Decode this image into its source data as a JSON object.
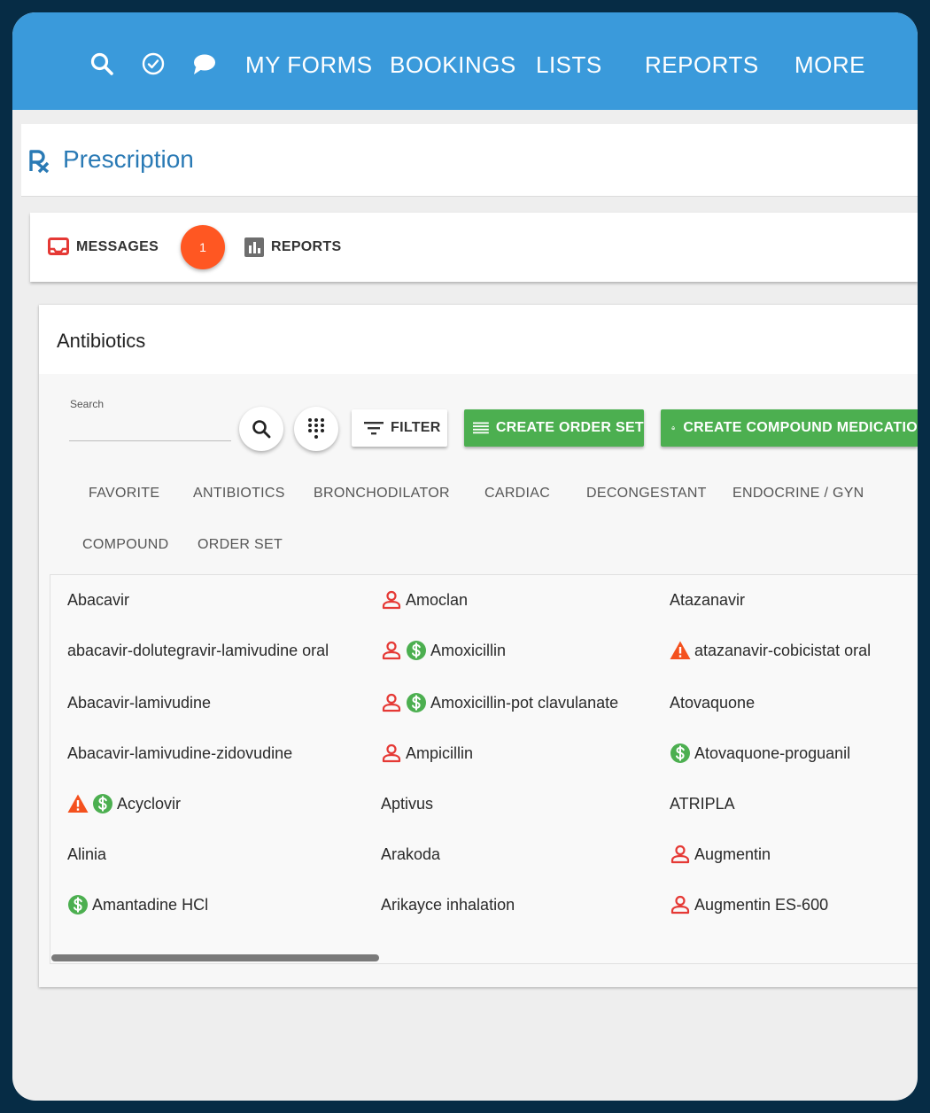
{
  "nav": {
    "icons": [
      "search-icon",
      "check-circle-icon",
      "chat-bubble-icon"
    ],
    "items": [
      "MY FORMS",
      "BOOKINGS",
      "LISTS",
      "REPORTS",
      "MORE"
    ]
  },
  "page": {
    "title": "Prescription",
    "icon": "rx-icon"
  },
  "tabs": [
    {
      "label": "MESSAGES",
      "icon": "inbox-icon",
      "badge": "1"
    },
    {
      "label": "REPORTS",
      "icon": "bar-chart-icon"
    }
  ],
  "card": {
    "title": "Antibiotics",
    "search": {
      "label": "Search",
      "value": ""
    },
    "buttons": {
      "filter": "FILTER",
      "create_order_set": "CREATE ORDER SET",
      "create_compound": "CREATE COMPOUND MEDICATIO"
    },
    "categories": [
      "FAVORITE",
      "ANTIBIOTICS",
      "BRONCHODILATOR",
      "CARDIAC",
      "DECONGESTANT",
      "ENDOCRINE / GYN",
      "COMPOUND",
      "ORDER SET"
    ],
    "columns": [
      [
        {
          "name": "Abacavir",
          "icons": []
        },
        {
          "name": "abacavir-dolutegravir-lamivudine oral",
          "icons": []
        },
        {
          "name": "Abacavir-lamivudine",
          "icons": []
        },
        {
          "name": "Abacavir-lamivudine-zidovudine",
          "icons": []
        },
        {
          "name": "Acyclovir",
          "icons": [
            "warning-icon",
            "dollar-icon"
          ]
        },
        {
          "name": "Alinia",
          "icons": []
        },
        {
          "name": "Amantadine HCl",
          "icons": [
            "dollar-icon"
          ]
        }
      ],
      [
        {
          "name": "Amoclan",
          "icons": [
            "person-icon"
          ]
        },
        {
          "name": "Amoxicillin",
          "icons": [
            "person-icon",
            "dollar-icon"
          ]
        },
        {
          "name": "Amoxicillin-pot clavulanate",
          "icons": [
            "person-icon",
            "dollar-icon"
          ]
        },
        {
          "name": "Ampicillin",
          "icons": [
            "person-icon"
          ]
        },
        {
          "name": "Aptivus",
          "icons": []
        },
        {
          "name": "Arakoda",
          "icons": []
        },
        {
          "name": "Arikayce inhalation",
          "icons": []
        }
      ],
      [
        {
          "name": "Atazanavir",
          "icons": []
        },
        {
          "name": "atazanavir-cobicistat oral",
          "icons": [
            "warning-icon"
          ]
        },
        {
          "name": "Atovaquone",
          "icons": []
        },
        {
          "name": "Atovaquone-proguanil",
          "icons": [
            "dollar-icon"
          ]
        },
        {
          "name": "ATRIPLA",
          "icons": []
        },
        {
          "name": "Augmentin",
          "icons": [
            "person-icon"
          ]
        },
        {
          "name": "Augmentin ES-600",
          "icons": [
            "person-icon"
          ]
        }
      ]
    ]
  },
  "colors": {
    "topbar": "#3a9adb",
    "title": "#2a7ab5",
    "green": "#4caf50",
    "badge": "#ff5722",
    "person": "#e53935",
    "warning": "#f4511e"
  }
}
